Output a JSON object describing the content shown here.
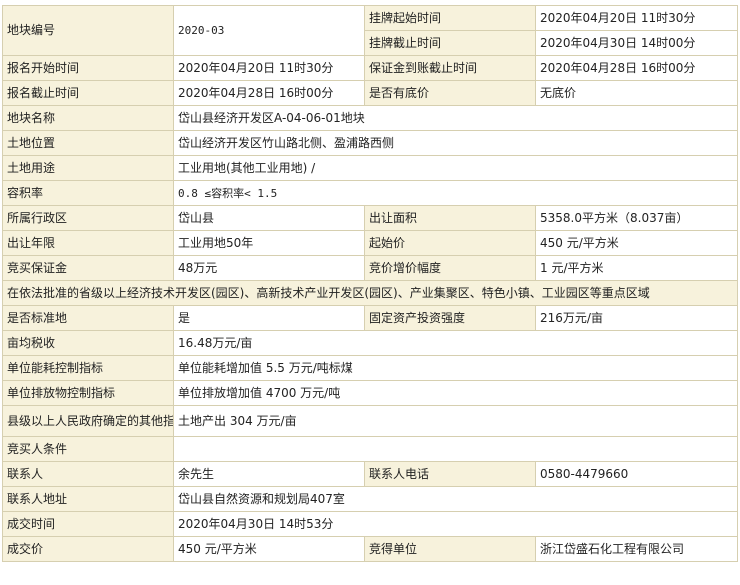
{
  "rows": {
    "plot_no": {
      "label": "地块编号",
      "value": "2020-03"
    },
    "listing_start": {
      "label": "挂牌起始时间",
      "value": "2020年04月20日 11时30分"
    },
    "listing_end": {
      "label": "挂牌截止时间",
      "value": "2020年04月30日 14时00分"
    },
    "signup_start": {
      "label": "报名开始时间",
      "value": "2020年04月20日 11时30分"
    },
    "deposit_deadline": {
      "label": "保证金到账截止时间",
      "value": "2020年04月28日 16时00分"
    },
    "signup_end": {
      "label": "报名截止时间",
      "value": "2020年04月28日 16时00分"
    },
    "reserve_price": {
      "label": "是否有底价",
      "value": "无底价"
    },
    "plot_name": {
      "label": "地块名称",
      "value": "岱山县经济开发区A-04-06-01地块"
    },
    "location": {
      "label": "土地位置",
      "value": "岱山经济开发区竹山路北侧、盈浦路西侧"
    },
    "land_use": {
      "label": "土地用途",
      "value": "工业用地(其他工业用地) /"
    },
    "plot_ratio": {
      "label": "容积率",
      "value": "0.8 ≤容积率< 1.5"
    },
    "district": {
      "label": "所属行政区",
      "value": "岱山县"
    },
    "area": {
      "label": "出让面积",
      "value": "5358.0平方米（8.037亩）"
    },
    "term": {
      "label": "出让年限",
      "value": "工业用地50年"
    },
    "start_price": {
      "label": "起始价",
      "value": "450 元/平方米"
    },
    "bid_deposit": {
      "label": "竞买保证金",
      "value": "48万元"
    },
    "increment": {
      "label": "竞价增价幅度",
      "value": "1 元/平方米"
    },
    "zone_notice": {
      "value": "在依法批准的省级以上经济技术开发区(园区)、高新技术产业开发区(园区)、产业集聚区、特色小镇、工业园区等重点区域"
    },
    "standard_land": {
      "label": "是否标准地",
      "value": "是"
    },
    "investment": {
      "label": "固定资产投资强度",
      "value": "216万元/亩"
    },
    "tax_per_mu": {
      "label": "亩均税收",
      "value": "16.48万元/亩"
    },
    "energy": {
      "label": "单位能耗控制指标",
      "value": "单位能耗增加值 5.5 万元/吨标煤"
    },
    "emission": {
      "label": "单位排放物控制指标",
      "value": "单位排放增加值 4700 万元/吨"
    },
    "other_index": {
      "label": "县级以上人民政府确定的其他指标",
      "value": "土地产出 304 万元/亩"
    },
    "conditions": {
      "label": "竞买人条件",
      "value": ""
    },
    "contact": {
      "label": "联系人",
      "value": "余先生"
    },
    "phone": {
      "label": "联系人电话",
      "value": "0580-4479660"
    },
    "address": {
      "label": "联系人地址",
      "value": "岱山县自然资源和规划局407室"
    },
    "deal_time": {
      "label": "成交时间",
      "value": "2020年04月30日 14时53分"
    },
    "deal_price": {
      "label": "成交价",
      "value": "450 元/平方米"
    },
    "winner": {
      "label": "竞得单位",
      "value": "浙江岱盛石化工程有限公司"
    }
  }
}
